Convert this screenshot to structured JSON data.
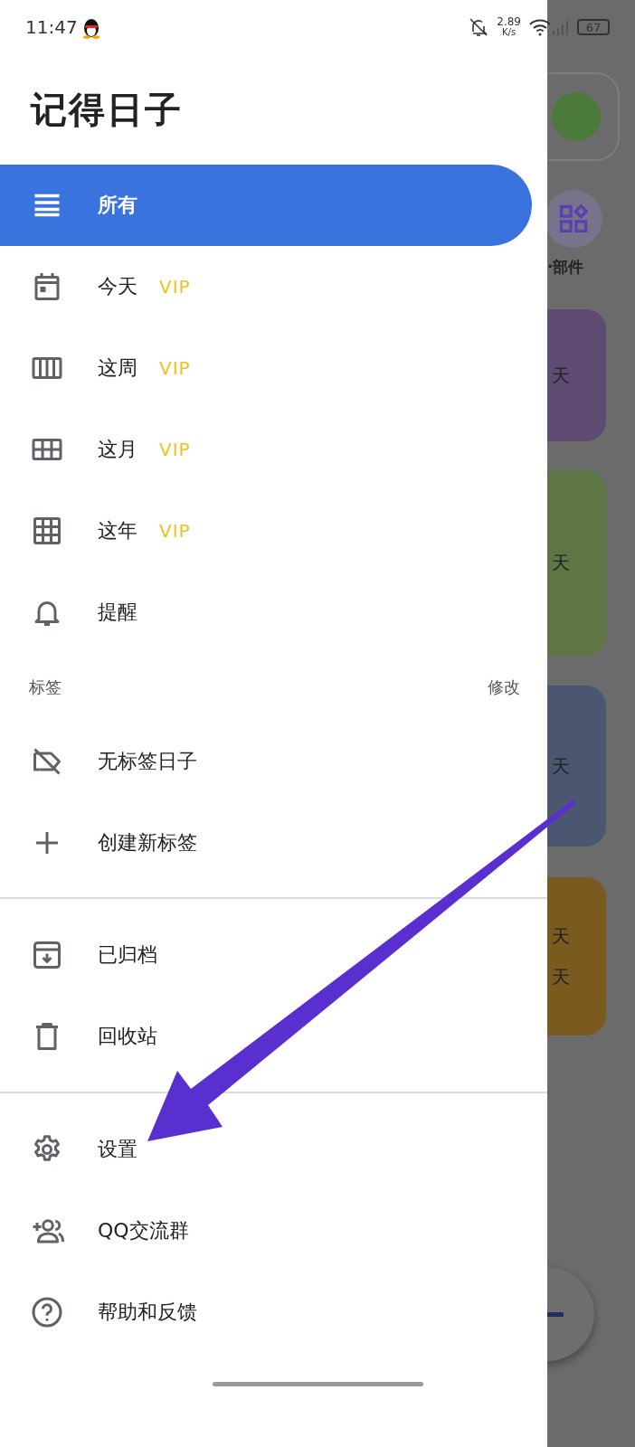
{
  "status_bar": {
    "time": "11:47",
    "speed": "2.89",
    "speed_unit": "K/s",
    "battery": "67"
  },
  "app_title": "记得日子",
  "main_items": [
    {
      "label": "所有",
      "selected": true
    },
    {
      "label": "今天",
      "badge": "VIP",
      "selected": false
    },
    {
      "label": "这周",
      "badge": "VIP",
      "selected": false
    },
    {
      "label": "这月",
      "badge": "VIP",
      "selected": false
    },
    {
      "label": "这年",
      "badge": "VIP",
      "selected": false
    },
    {
      "label": "提醒",
      "selected": false
    }
  ],
  "tags_header": {
    "title": "标签",
    "action": "修改"
  },
  "tag_items": [
    {
      "label": "无标签日子",
      "selected": false
    },
    {
      "label": "创建新标签",
      "selected": false
    }
  ],
  "archive_items": [
    {
      "label": "已归档",
      "selected": false
    },
    {
      "label": "回收站",
      "selected": false
    }
  ],
  "footer_items": [
    {
      "label": "设置",
      "selected": false
    },
    {
      "label": "QQ交流群",
      "selected": false
    },
    {
      "label": "帮助和反馈",
      "selected": false
    }
  ],
  "background_screen": {
    "widgets_label": "·部件",
    "cards": [
      {
        "color": "#5e4b72",
        "texts": [
          "天"
        ]
      },
      {
        "color": "#5d7644",
        "texts": [
          "天"
        ]
      },
      {
        "color": "#4b5770",
        "texts": [
          "天"
        ]
      },
      {
        "color": "#7a5a1f",
        "texts": [
          "天",
          "天"
        ]
      }
    ]
  }
}
